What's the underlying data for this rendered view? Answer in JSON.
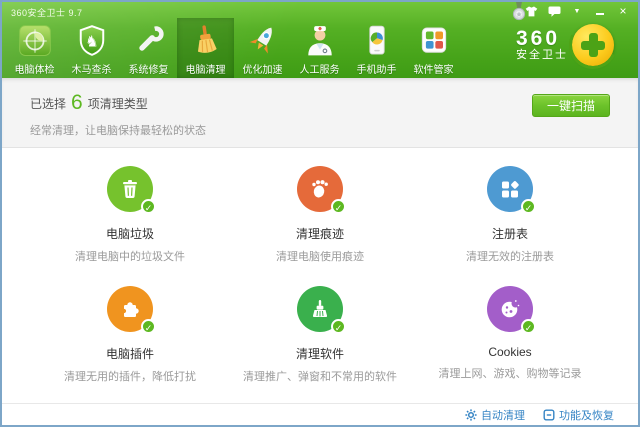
{
  "window": {
    "title": "360安全卫士 9.7"
  },
  "toolbar": {
    "tabs": [
      {
        "label": "电脑体检",
        "icon": "checkup-icon"
      },
      {
        "label": "木马查杀",
        "icon": "trojan-scan-icon"
      },
      {
        "label": "系统修复",
        "icon": "system-repair-icon"
      },
      {
        "label": "电脑清理",
        "icon": "cleanup-icon"
      },
      {
        "label": "优化加速",
        "icon": "speedup-icon"
      },
      {
        "label": "人工服务",
        "icon": "manual-service-icon"
      },
      {
        "label": "手机助手",
        "icon": "phone-assistant-icon"
      },
      {
        "label": "软件管家",
        "icon": "software-manager-icon"
      }
    ],
    "active_tab": "电脑清理",
    "logo": {
      "line1": "360",
      "line2": "安全卫士"
    }
  },
  "header": {
    "selected_prefix": "已选择",
    "selected_count": "6",
    "selected_suffix": "项清理类型",
    "subtitle": "经常清理，让电脑保持最轻松的状态",
    "scan_button_label": "一键扫描"
  },
  "cleanup_grid": {
    "items": [
      {
        "title": "电脑垃圾",
        "desc": "清理电脑中的垃圾文件",
        "icon": "trash-icon",
        "color": "#76c22d",
        "checked": true
      },
      {
        "title": "清理痕迹",
        "desc": "清理电脑使用痕迹",
        "icon": "footprint-icon",
        "color": "#e56a3a",
        "checked": true
      },
      {
        "title": "注册表",
        "desc": "清理无效的注册表",
        "icon": "registry-icon",
        "color": "#4e9ad2",
        "checked": true
      },
      {
        "title": "电脑插件",
        "desc": "清理无用的插件，降低打扰",
        "icon": "plugin-icon",
        "color": "#f0941f",
        "checked": true
      },
      {
        "title": "清理软件",
        "desc": "清理推广、弹窗和不常用的软件",
        "icon": "brush-icon",
        "color": "#3ab04d",
        "checked": true
      },
      {
        "title": "Cookies",
        "desc": "清理上网、游戏、购物等记录",
        "icon": "cookie-icon",
        "color": "#a35ec9",
        "checked": true
      }
    ]
  },
  "footer": {
    "auto_clean_label": "自动清理",
    "restore_label": "功能及恢复"
  },
  "colors": {
    "brand_green": "#54b022",
    "accent_number": "#5db821",
    "button_green": "#6cc22a",
    "link_blue": "#3584c4",
    "subheader_bg": "#f4f4f4"
  }
}
